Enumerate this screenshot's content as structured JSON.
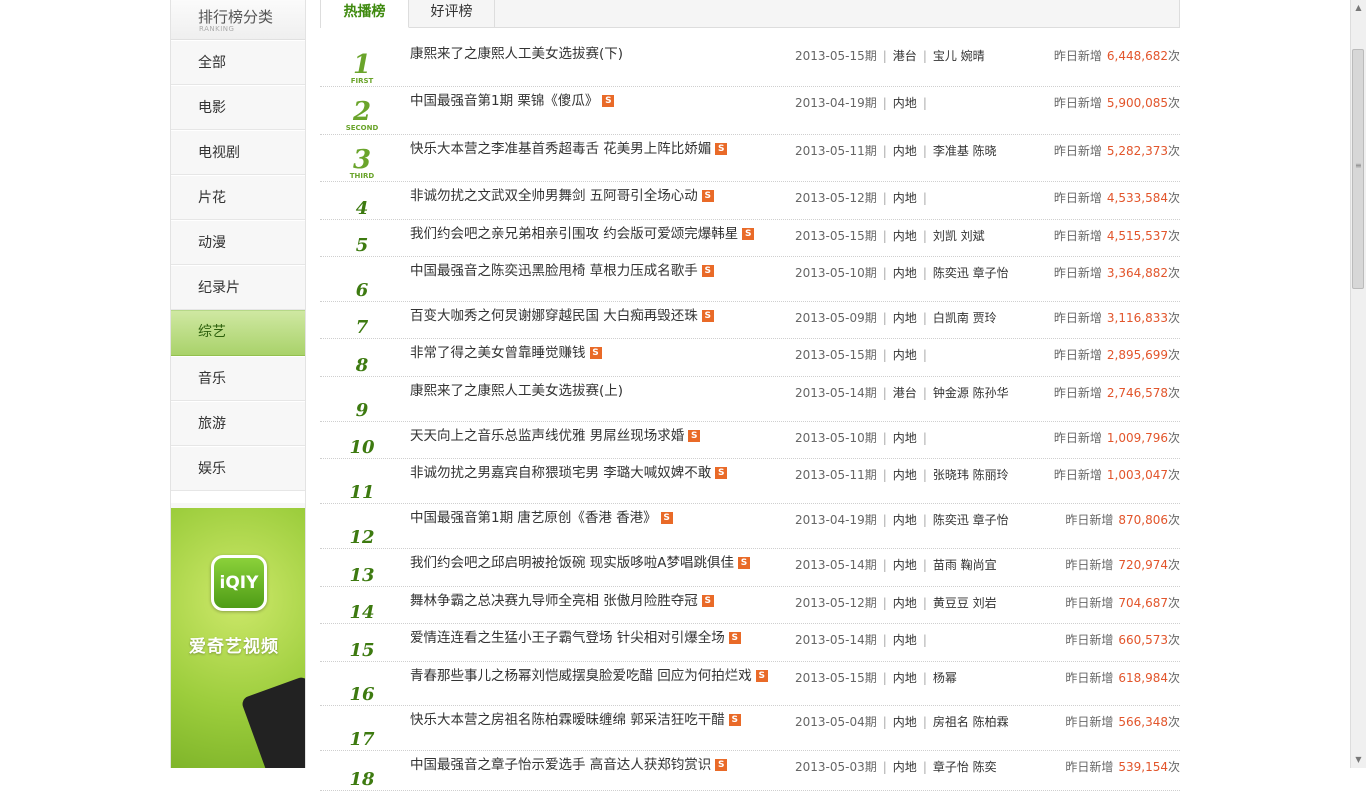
{
  "sidebar": {
    "title": "排行榜分类",
    "subtitle": "RANKING",
    "items": [
      {
        "label": "全部",
        "active": false
      },
      {
        "label": "电影",
        "active": false
      },
      {
        "label": "电视剧",
        "active": false
      },
      {
        "label": "片花",
        "active": false
      },
      {
        "label": "动漫",
        "active": false
      },
      {
        "label": "纪录片",
        "active": false
      },
      {
        "label": "综艺",
        "active": true
      },
      {
        "label": "音乐",
        "active": false
      },
      {
        "label": "旅游",
        "active": false
      },
      {
        "label": "娱乐",
        "active": false
      }
    ]
  },
  "ad": {
    "logo": "iQIY",
    "text": "爱奇艺视频"
  },
  "tabs": [
    {
      "label": "热播榜",
      "active": true
    },
    {
      "label": "好评榜",
      "active": false
    }
  ],
  "stat_label": "昨日新增",
  "stat_unit": "次",
  "badge": "S",
  "rank_words": [
    "FIRST",
    "SECOND",
    "THIRD"
  ],
  "rows": [
    {
      "rank": "1",
      "title": "康熙来了之康熙人工美女选拔赛(下)",
      "badge": false,
      "date": "2013-05-15期",
      "region": "港台",
      "cast": "宝儿 婉晴",
      "count": "6,448,682"
    },
    {
      "rank": "2",
      "title": "中国最强音第1期 栗锦《傻瓜》",
      "badge": true,
      "date": "2013-04-19期",
      "region": "内地",
      "cast": "",
      "count": "5,900,085"
    },
    {
      "rank": "3",
      "title": "快乐大本营之李准基首秀超毒舌 花美男上阵比娇媚",
      "badge": true,
      "date": "2013-05-11期",
      "region": "内地",
      "cast": "李准基 陈晓",
      "count": "5,282,373"
    },
    {
      "rank": "4",
      "title": "非诚勿扰之文武双全帅男舞剑 五阿哥引全场心动",
      "badge": true,
      "date": "2013-05-12期",
      "region": "内地",
      "cast": "",
      "count": "4,533,584"
    },
    {
      "rank": "5",
      "title": "我们约会吧之亲兄弟相亲引围攻 约会版可爱颂完爆韩星",
      "badge": true,
      "date": "2013-05-15期",
      "region": "内地",
      "cast": "刘凯 刘斌",
      "count": "4,515,537"
    },
    {
      "rank": "6",
      "title": "中国最强音之陈奕迅黑脸甩椅 草根力压成名歌手",
      "badge": true,
      "date": "2013-05-10期",
      "region": "内地",
      "cast": "陈奕迅 章子怡",
      "count": "3,364,882"
    },
    {
      "rank": "7",
      "title": "百变大咖秀之何炅谢娜穿越民国 大白痴再毁还珠",
      "badge": true,
      "date": "2013-05-09期",
      "region": "内地",
      "cast": "白凯南 贾玲",
      "count": "3,116,833"
    },
    {
      "rank": "8",
      "title": "非常了得之美女曾靠睡觉赚钱",
      "badge": true,
      "date": "2013-05-15期",
      "region": "内地",
      "cast": "",
      "count": "2,895,699"
    },
    {
      "rank": "9",
      "title": "康熙来了之康熙人工美女选拔赛(上)",
      "badge": false,
      "date": "2013-05-14期",
      "region": "港台",
      "cast": "钟金源 陈孙华",
      "count": "2,746,578"
    },
    {
      "rank": "10",
      "title": "天天向上之音乐总监声线优雅 男屌丝现场求婚",
      "badge": true,
      "date": "2013-05-10期",
      "region": "内地",
      "cast": "",
      "count": "1,009,796"
    },
    {
      "rank": "11",
      "title": "非诚勿扰之男嘉宾自称猥琐宅男 李璐大喊奴婢不敢",
      "badge": true,
      "date": "2013-05-11期",
      "region": "内地",
      "cast": "张晓玮 陈丽玲",
      "count": "1,003,047"
    },
    {
      "rank": "12",
      "title": "中国最强音第1期 唐艺原创《香港 香港》",
      "badge": true,
      "date": "2013-04-19期",
      "region": "内地",
      "cast": "陈奕迅 章子怡",
      "count": "870,806"
    },
    {
      "rank": "13",
      "title": "我们约会吧之邱启明被抢饭碗 现实版哆啦A梦唱跳俱佳",
      "badge": true,
      "date": "2013-05-14期",
      "region": "内地",
      "cast": "苗雨 鞠尚宜",
      "count": "720,974"
    },
    {
      "rank": "14",
      "title": "舞林争霸之总决赛九导师全亮相 张傲月险胜夺冠",
      "badge": true,
      "date": "2013-05-12期",
      "region": "内地",
      "cast": "黄豆豆 刘岩",
      "count": "704,687"
    },
    {
      "rank": "15",
      "title": "爱情连连看之生猛小王子霸气登场 针尖相对引爆全场",
      "badge": true,
      "date": "2013-05-14期",
      "region": "内地",
      "cast": "",
      "count": "660,573"
    },
    {
      "rank": "16",
      "title": "青春那些事儿之杨幂刘恺威摆臭脸爱吃醋 回应为何拍烂戏",
      "badge": true,
      "date": "2013-05-15期",
      "region": "内地",
      "cast": "杨幂",
      "count": "618,984"
    },
    {
      "rank": "17",
      "title": "快乐大本营之房祖名陈柏霖暧昧缠绵 郭采洁狂吃干醋",
      "badge": true,
      "date": "2013-05-04期",
      "region": "内地",
      "cast": "房祖名 陈柏霖",
      "count": "566,348"
    },
    {
      "rank": "18",
      "title": "中国最强音之章子怡示爱选手 高音达人获郑钧赏识",
      "badge": true,
      "date": "2013-05-03期",
      "region": "内地",
      "cast": "章子怡 陈奕",
      "count": "539,154"
    }
  ]
}
